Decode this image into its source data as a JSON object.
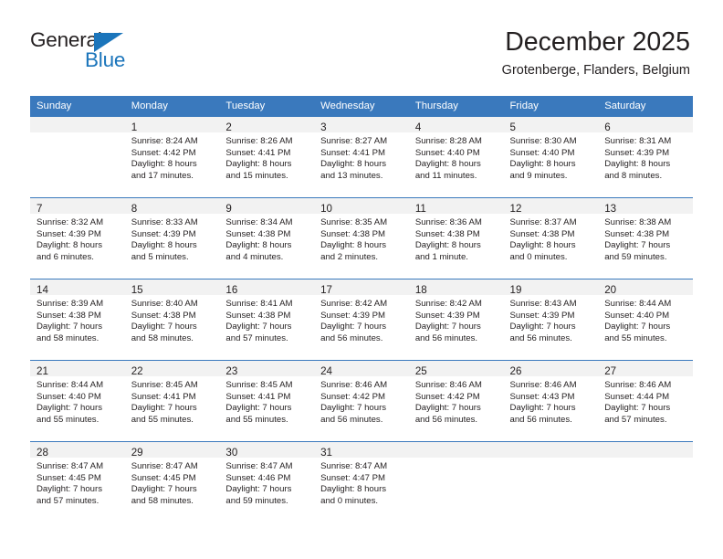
{
  "brand": {
    "name_part1": "General",
    "name_part2": "Blue",
    "logo_icon": "blue-triangle-logo"
  },
  "header": {
    "title": "December 2025",
    "subtitle": "Grotenberge, Flanders, Belgium"
  },
  "colors": {
    "header_blue": "#3a79bd",
    "brand_blue": "#1b75bb",
    "daynum_band": "#f2f2f2",
    "text": "#231f20"
  },
  "weekday_headers": [
    "Sunday",
    "Monday",
    "Tuesday",
    "Wednesday",
    "Thursday",
    "Friday",
    "Saturday"
  ],
  "weeks": [
    [
      {
        "day": "",
        "sunrise": "",
        "sunset": "",
        "daylight_line1": "",
        "daylight_line2": ""
      },
      {
        "day": "1",
        "sunrise": "Sunrise: 8:24 AM",
        "sunset": "Sunset: 4:42 PM",
        "daylight_line1": "Daylight: 8 hours",
        "daylight_line2": "and 17 minutes."
      },
      {
        "day": "2",
        "sunrise": "Sunrise: 8:26 AM",
        "sunset": "Sunset: 4:41 PM",
        "daylight_line1": "Daylight: 8 hours",
        "daylight_line2": "and 15 minutes."
      },
      {
        "day": "3",
        "sunrise": "Sunrise: 8:27 AM",
        "sunset": "Sunset: 4:41 PM",
        "daylight_line1": "Daylight: 8 hours",
        "daylight_line2": "and 13 minutes."
      },
      {
        "day": "4",
        "sunrise": "Sunrise: 8:28 AM",
        "sunset": "Sunset: 4:40 PM",
        "daylight_line1": "Daylight: 8 hours",
        "daylight_line2": "and 11 minutes."
      },
      {
        "day": "5",
        "sunrise": "Sunrise: 8:30 AM",
        "sunset": "Sunset: 4:40 PM",
        "daylight_line1": "Daylight: 8 hours",
        "daylight_line2": "and 9 minutes."
      },
      {
        "day": "6",
        "sunrise": "Sunrise: 8:31 AM",
        "sunset": "Sunset: 4:39 PM",
        "daylight_line1": "Daylight: 8 hours",
        "daylight_line2": "and 8 minutes."
      }
    ],
    [
      {
        "day": "7",
        "sunrise": "Sunrise: 8:32 AM",
        "sunset": "Sunset: 4:39 PM",
        "daylight_line1": "Daylight: 8 hours",
        "daylight_line2": "and 6 minutes."
      },
      {
        "day": "8",
        "sunrise": "Sunrise: 8:33 AM",
        "sunset": "Sunset: 4:39 PM",
        "daylight_line1": "Daylight: 8 hours",
        "daylight_line2": "and 5 minutes."
      },
      {
        "day": "9",
        "sunrise": "Sunrise: 8:34 AM",
        "sunset": "Sunset: 4:38 PM",
        "daylight_line1": "Daylight: 8 hours",
        "daylight_line2": "and 4 minutes."
      },
      {
        "day": "10",
        "sunrise": "Sunrise: 8:35 AM",
        "sunset": "Sunset: 4:38 PM",
        "daylight_line1": "Daylight: 8 hours",
        "daylight_line2": "and 2 minutes."
      },
      {
        "day": "11",
        "sunrise": "Sunrise: 8:36 AM",
        "sunset": "Sunset: 4:38 PM",
        "daylight_line1": "Daylight: 8 hours",
        "daylight_line2": "and 1 minute."
      },
      {
        "day": "12",
        "sunrise": "Sunrise: 8:37 AM",
        "sunset": "Sunset: 4:38 PM",
        "daylight_line1": "Daylight: 8 hours",
        "daylight_line2": "and 0 minutes."
      },
      {
        "day": "13",
        "sunrise": "Sunrise: 8:38 AM",
        "sunset": "Sunset: 4:38 PM",
        "daylight_line1": "Daylight: 7 hours",
        "daylight_line2": "and 59 minutes."
      }
    ],
    [
      {
        "day": "14",
        "sunrise": "Sunrise: 8:39 AM",
        "sunset": "Sunset: 4:38 PM",
        "daylight_line1": "Daylight: 7 hours",
        "daylight_line2": "and 58 minutes."
      },
      {
        "day": "15",
        "sunrise": "Sunrise: 8:40 AM",
        "sunset": "Sunset: 4:38 PM",
        "daylight_line1": "Daylight: 7 hours",
        "daylight_line2": "and 58 minutes."
      },
      {
        "day": "16",
        "sunrise": "Sunrise: 8:41 AM",
        "sunset": "Sunset: 4:38 PM",
        "daylight_line1": "Daylight: 7 hours",
        "daylight_line2": "and 57 minutes."
      },
      {
        "day": "17",
        "sunrise": "Sunrise: 8:42 AM",
        "sunset": "Sunset: 4:39 PM",
        "daylight_line1": "Daylight: 7 hours",
        "daylight_line2": "and 56 minutes."
      },
      {
        "day": "18",
        "sunrise": "Sunrise: 8:42 AM",
        "sunset": "Sunset: 4:39 PM",
        "daylight_line1": "Daylight: 7 hours",
        "daylight_line2": "and 56 minutes."
      },
      {
        "day": "19",
        "sunrise": "Sunrise: 8:43 AM",
        "sunset": "Sunset: 4:39 PM",
        "daylight_line1": "Daylight: 7 hours",
        "daylight_line2": "and 56 minutes."
      },
      {
        "day": "20",
        "sunrise": "Sunrise: 8:44 AM",
        "sunset": "Sunset: 4:40 PM",
        "daylight_line1": "Daylight: 7 hours",
        "daylight_line2": "and 55 minutes."
      }
    ],
    [
      {
        "day": "21",
        "sunrise": "Sunrise: 8:44 AM",
        "sunset": "Sunset: 4:40 PM",
        "daylight_line1": "Daylight: 7 hours",
        "daylight_line2": "and 55 minutes."
      },
      {
        "day": "22",
        "sunrise": "Sunrise: 8:45 AM",
        "sunset": "Sunset: 4:41 PM",
        "daylight_line1": "Daylight: 7 hours",
        "daylight_line2": "and 55 minutes."
      },
      {
        "day": "23",
        "sunrise": "Sunrise: 8:45 AM",
        "sunset": "Sunset: 4:41 PM",
        "daylight_line1": "Daylight: 7 hours",
        "daylight_line2": "and 55 minutes."
      },
      {
        "day": "24",
        "sunrise": "Sunrise: 8:46 AM",
        "sunset": "Sunset: 4:42 PM",
        "daylight_line1": "Daylight: 7 hours",
        "daylight_line2": "and 56 minutes."
      },
      {
        "day": "25",
        "sunrise": "Sunrise: 8:46 AM",
        "sunset": "Sunset: 4:42 PM",
        "daylight_line1": "Daylight: 7 hours",
        "daylight_line2": "and 56 minutes."
      },
      {
        "day": "26",
        "sunrise": "Sunrise: 8:46 AM",
        "sunset": "Sunset: 4:43 PM",
        "daylight_line1": "Daylight: 7 hours",
        "daylight_line2": "and 56 minutes."
      },
      {
        "day": "27",
        "sunrise": "Sunrise: 8:46 AM",
        "sunset": "Sunset: 4:44 PM",
        "daylight_line1": "Daylight: 7 hours",
        "daylight_line2": "and 57 minutes."
      }
    ],
    [
      {
        "day": "28",
        "sunrise": "Sunrise: 8:47 AM",
        "sunset": "Sunset: 4:45 PM",
        "daylight_line1": "Daylight: 7 hours",
        "daylight_line2": "and 57 minutes."
      },
      {
        "day": "29",
        "sunrise": "Sunrise: 8:47 AM",
        "sunset": "Sunset: 4:45 PM",
        "daylight_line1": "Daylight: 7 hours",
        "daylight_line2": "and 58 minutes."
      },
      {
        "day": "30",
        "sunrise": "Sunrise: 8:47 AM",
        "sunset": "Sunset: 4:46 PM",
        "daylight_line1": "Daylight: 7 hours",
        "daylight_line2": "and 59 minutes."
      },
      {
        "day": "31",
        "sunrise": "Sunrise: 8:47 AM",
        "sunset": "Sunset: 4:47 PM",
        "daylight_line1": "Daylight: 8 hours",
        "daylight_line2": "and 0 minutes."
      },
      {
        "day": "",
        "sunrise": "",
        "sunset": "",
        "daylight_line1": "",
        "daylight_line2": ""
      },
      {
        "day": "",
        "sunrise": "",
        "sunset": "",
        "daylight_line1": "",
        "daylight_line2": ""
      },
      {
        "day": "",
        "sunrise": "",
        "sunset": "",
        "daylight_line1": "",
        "daylight_line2": ""
      }
    ]
  ]
}
